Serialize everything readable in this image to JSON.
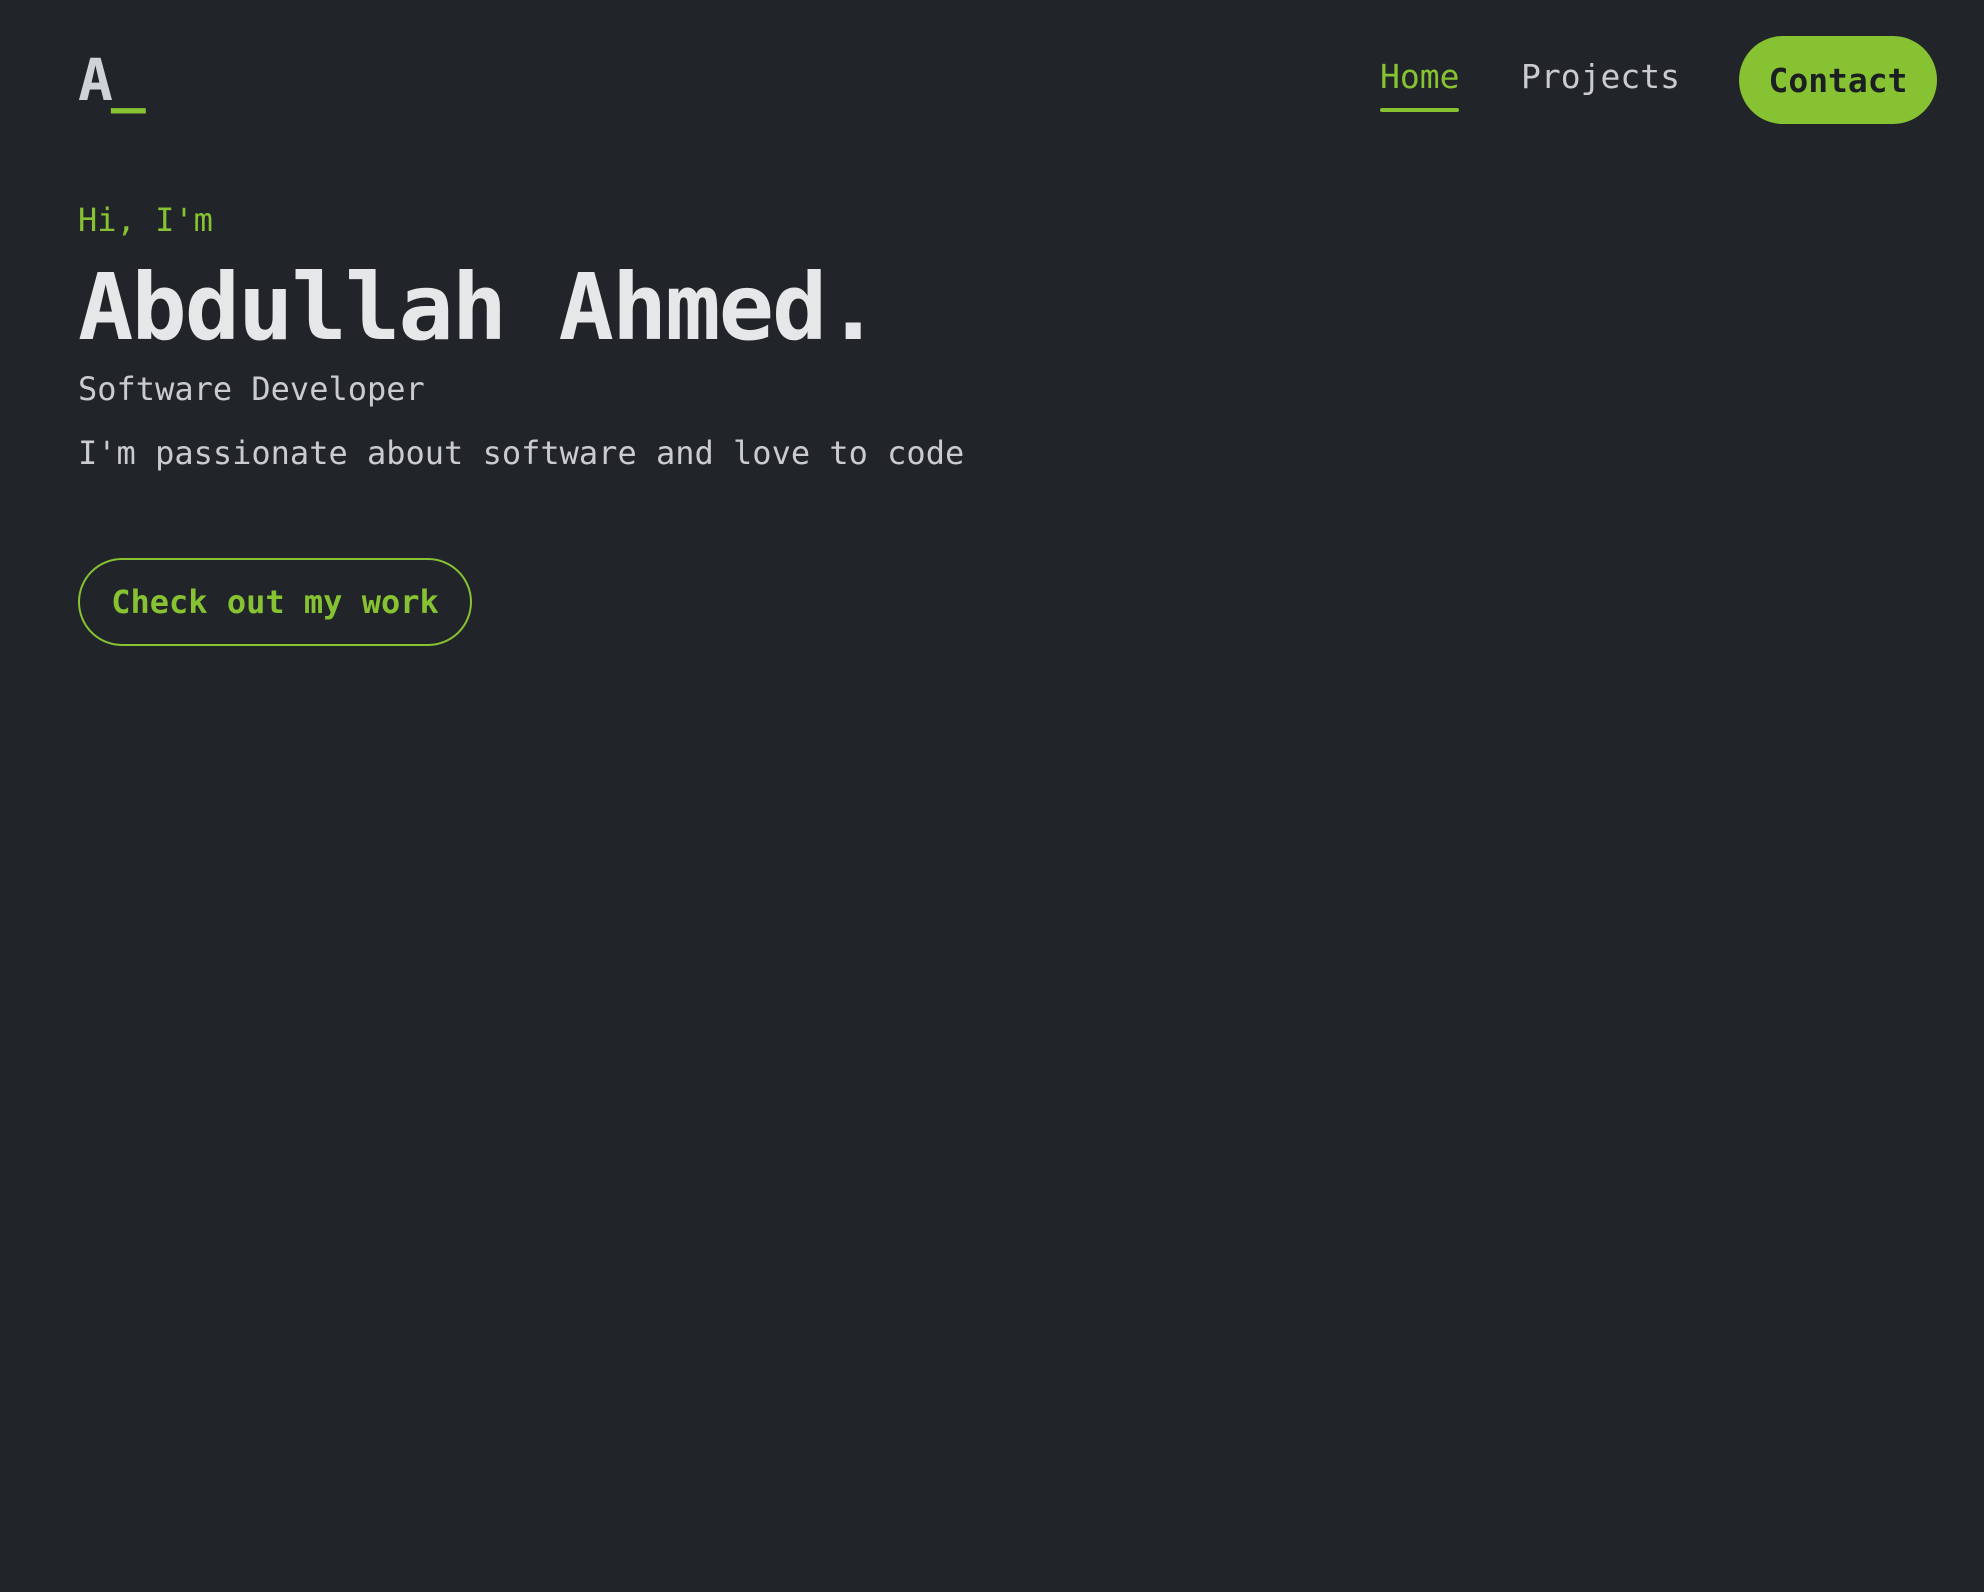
{
  "brand": {
    "logo_letter": "A",
    "logo_cursor": "_"
  },
  "nav": {
    "items": [
      {
        "label": "Home",
        "active": true
      },
      {
        "label": "Projects",
        "active": false
      }
    ],
    "contact_label": "Contact"
  },
  "hero": {
    "greeting": "Hi, I'm",
    "name": "Abdullah Ahmed.",
    "role": "Software Developer",
    "tagline": "I'm passionate about software and love to code",
    "cta_label": "Check out my work"
  },
  "colors": {
    "background": "#212529",
    "accent": "#86c232",
    "text_primary": "#e6e7e8",
    "text_secondary": "#c9cbce"
  }
}
